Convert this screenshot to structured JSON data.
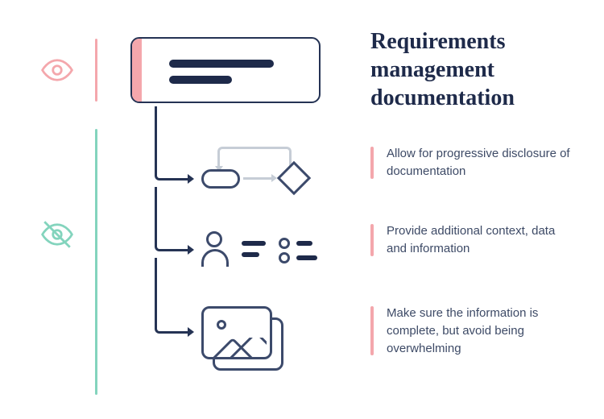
{
  "title": "Requirements management documentation",
  "bullets": [
    "Allow for progressive disclosure of documentation",
    "Provide additional context, data and information",
    "Make sure the information is complete, but avoid being overwhelming"
  ],
  "icons": {
    "visible": "eye-icon",
    "hidden": "eye-off-icon",
    "process": "process-flow-icon",
    "user_list": "user-list-icon",
    "image_stack": "image-stack-icon"
  },
  "colors": {
    "navy": "#1e2a4a",
    "pink": "#f4a7ac",
    "mint": "#83d4bd",
    "blue_stroke": "#3c4a6b",
    "grey_stroke": "#c6cdd6",
    "body_text": "#3d4a66"
  }
}
